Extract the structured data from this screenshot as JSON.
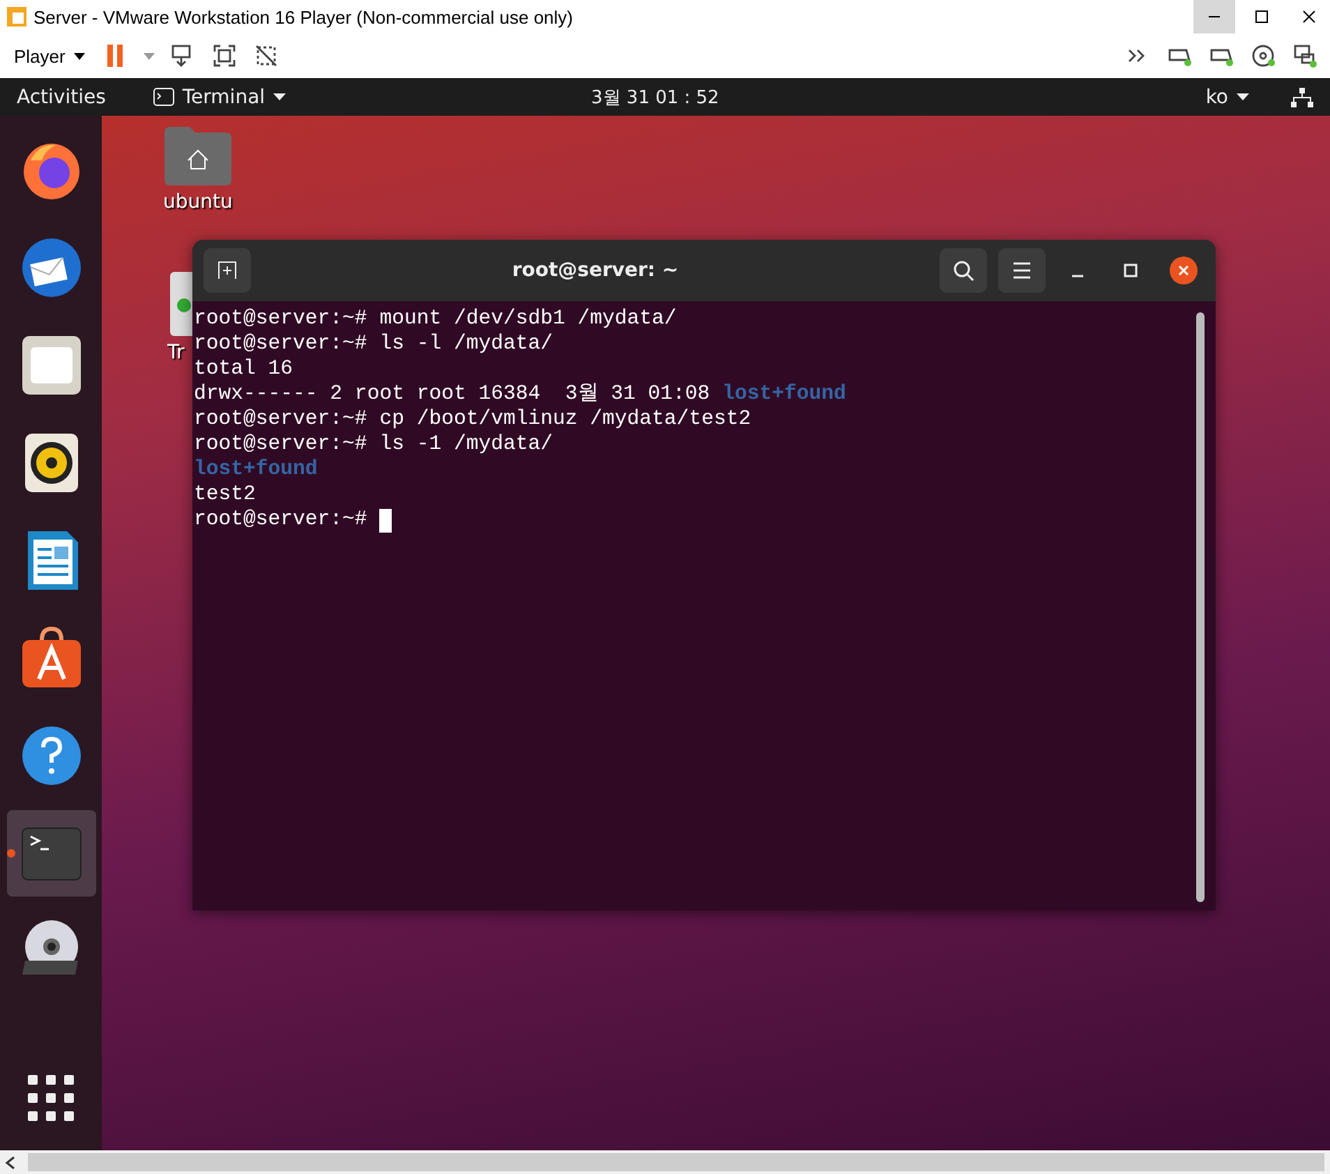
{
  "window": {
    "title": "Server - VMware Workstation 16 Player (Non-commercial use only)"
  },
  "toolbar": {
    "player_menu": "Player"
  },
  "top_bar": {
    "activities": "Activities",
    "app_menu": "Terminal",
    "clock": "3월 31  01 : 52",
    "language": "ko"
  },
  "dock": [
    {
      "kind": "firefox",
      "selected": false,
      "running": false
    },
    {
      "kind": "mail",
      "selected": false,
      "running": false
    },
    {
      "kind": "files",
      "selected": false,
      "running": false
    },
    {
      "kind": "speaker",
      "selected": false,
      "running": false
    },
    {
      "kind": "writer",
      "selected": false,
      "running": false
    },
    {
      "kind": "store",
      "selected": false,
      "running": false
    },
    {
      "kind": "help",
      "selected": false,
      "running": false
    },
    {
      "kind": "terminal",
      "selected": true,
      "running": true
    },
    {
      "kind": "dvd",
      "selected": false,
      "running": false
    }
  ],
  "desktop_icons": [
    {
      "kind": "home",
      "label": "ubuntu"
    },
    {
      "kind": "trash",
      "label": "Tr"
    }
  ],
  "terminal": {
    "title": "root@server: ~",
    "lines": [
      [
        {
          "kind": "plain",
          "text": "root@server:~# mount /dev/sdb1 /mydata/"
        }
      ],
      [
        {
          "kind": "plain",
          "text": "root@server:~# ls -l /mydata/"
        }
      ],
      [
        {
          "kind": "plain",
          "text": "total 16"
        }
      ],
      [
        {
          "kind": "plain",
          "text": "drwx------ 2 root root 16384  3월 31 01:08 "
        },
        {
          "kind": "dir",
          "text": "lost+found"
        }
      ],
      [
        {
          "kind": "plain",
          "text": "root@server:~# cp /boot/vmlinuz /mydata/test2"
        }
      ],
      [
        {
          "kind": "plain",
          "text": "root@server:~# ls -1 /mydata/"
        }
      ],
      [
        {
          "kind": "dir",
          "text": "lost+found"
        }
      ],
      [
        {
          "kind": "plain",
          "text": "test2"
        }
      ],
      [
        {
          "kind": "plain",
          "text": "root@server:~# "
        }
      ]
    ]
  }
}
